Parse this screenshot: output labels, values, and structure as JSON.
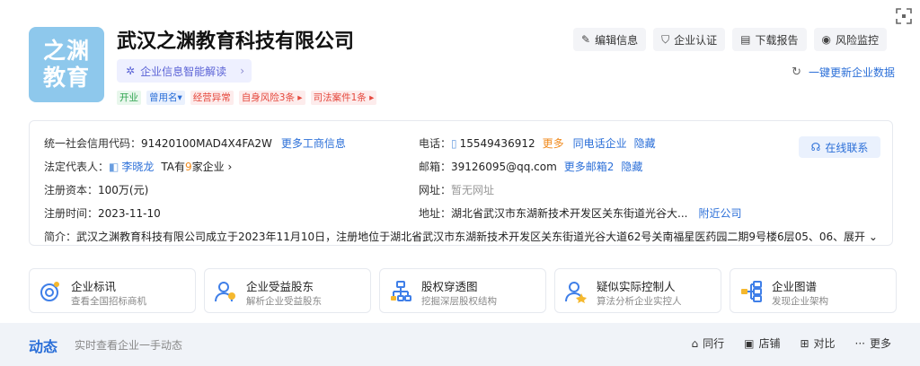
{
  "company": {
    "logo_text_line1": "之渊",
    "logo_text_line2": "教育",
    "name": "武汉之渊教育科技有限公司",
    "ai_label": "企业信息智能解读",
    "tags": [
      {
        "label": "开业",
        "color": "green"
      },
      {
        "label": "曾用名▾",
        "color": "blue"
      },
      {
        "label": "经营异常",
        "color": "red"
      },
      {
        "label": "自身风险3条 ▸",
        "color": "red"
      },
      {
        "label": "司法案件1条 ▸",
        "color": "red"
      }
    ]
  },
  "actions": [
    {
      "label": "编辑信息",
      "icon": "edit-icon",
      "glyph": "✎"
    },
    {
      "label": "企业认证",
      "icon": "shield-icon",
      "glyph": "⛉"
    },
    {
      "label": "下载报告",
      "icon": "report-icon",
      "glyph": "▤"
    },
    {
      "label": "风险监控",
      "icon": "eye-icon",
      "glyph": "◉"
    }
  ],
  "refresh_label": "一键更新企业数据",
  "info": {
    "credit_code_label": "统一社会信用代码：",
    "credit_code": "91420100MAD4X4FA2W",
    "more_business": "更多工商信息",
    "legal_rep_label": "法定代表人：",
    "legal_rep_name": "李晓龙",
    "legal_rep_extra_prefix": "TA有",
    "legal_rep_extra_count": "9",
    "legal_rep_extra_suffix": "家企业",
    "capital_label": "注册资本：",
    "capital": "100万(元)",
    "reg_time_label": "注册时间：",
    "reg_time": "2023-11-10",
    "phone_label": "电话：",
    "phone": "15549436912",
    "phone_more": "更多",
    "phone_same": "同电话企业",
    "phone_hide": "隐藏",
    "email_label": "邮箱：",
    "email": "39126095@qq.com",
    "email_more": "更多邮箱2",
    "email_hide": "隐藏",
    "website_label": "网址：",
    "website": "暂无网址",
    "address_label": "地址：",
    "address": "湖北省武汉市东湖新技术开发区关东街道光谷大...",
    "nearby": "附近公司",
    "contact_btn": "在线联系",
    "intro_label": "简介：",
    "intro": "武汉之渊教育科技有限公司成立于2023年11月10日，注册地位于湖北省武汉市东湖新技术开发区关东街道光谷大道62号关南福星医药园二期9号楼6层05、06、...",
    "expand": "展开"
  },
  "features": [
    {
      "title": "企业标讯",
      "sub": "查看全国招标商机",
      "icon": "bid-icon"
    },
    {
      "title": "企业受益股东",
      "sub": "解析企业受益股东",
      "icon": "shareholder-icon"
    },
    {
      "title": "股权穿透图",
      "sub": "挖掘深层股权结构",
      "icon": "equity-icon"
    },
    {
      "title": "疑似实际控制人",
      "sub": "算法分析企业实控人",
      "icon": "controller-icon"
    },
    {
      "title": "企业图谱",
      "sub": "发现企业架构",
      "icon": "graph-icon"
    }
  ],
  "dynamics": {
    "title": "动态",
    "subtitle": "实时查看企业一手动态",
    "actions": [
      {
        "label": "同行",
        "glyph": "⌂"
      },
      {
        "label": "店铺",
        "glyph": "▣"
      },
      {
        "label": "对比",
        "glyph": "⊞"
      },
      {
        "label": "更多",
        "glyph": "···"
      }
    ]
  },
  "colors": {
    "accent": "#2b6fd8",
    "logo_bg": "#8ec8ec",
    "danger": "#e5483d",
    "success": "#2fa44f"
  }
}
